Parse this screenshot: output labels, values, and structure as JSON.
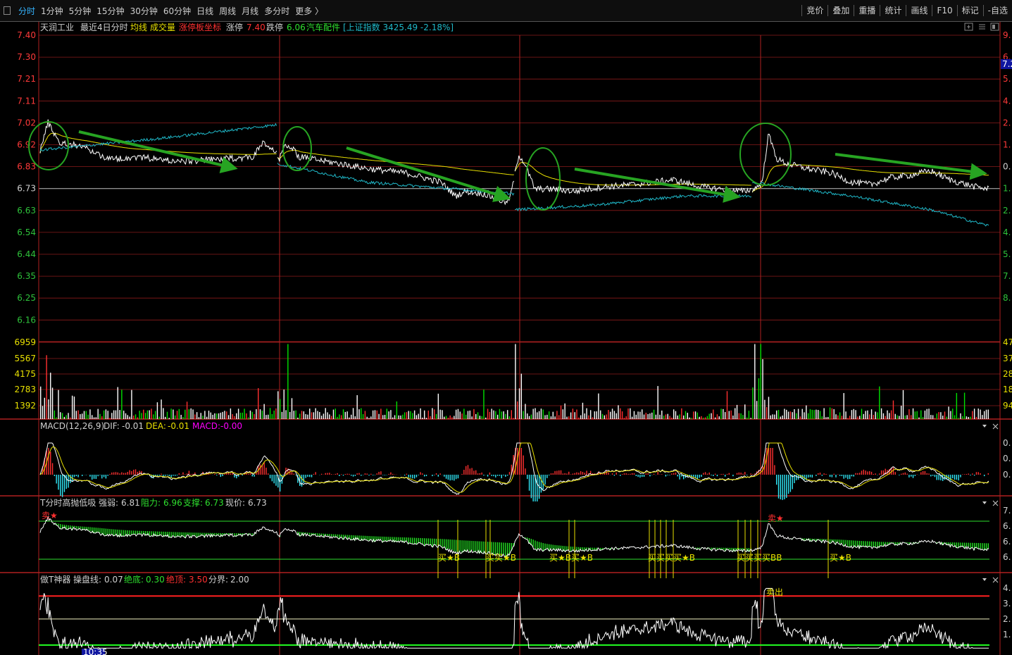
{
  "toolbar": {
    "tabs": [
      "分时",
      "1分钟",
      "5分钟",
      "15分钟",
      "30分钟",
      "60分钟",
      "日线",
      "周线",
      "月线",
      "多分时",
      "更多 〉"
    ],
    "active_tab": 0,
    "right_tools": [
      "竞价",
      "叠加",
      "重播",
      "统计",
      "画线",
      "F10",
      "标记",
      "-自选"
    ]
  },
  "header": {
    "stock_name": "天润工业",
    "range": "最近4日分时",
    "avg_label": "均线",
    "vol_label": "成交量",
    "limit_axis_label": "涨停板坐标",
    "limit_up_label": "涨停",
    "limit_up_value": "7.40",
    "limit_down_label": "跌停",
    "limit_down_value": "6.06",
    "sector": "汽车配件",
    "index_text": "[上证指数 3425.49 -2.18%]"
  },
  "price_axis": {
    "labels": [
      "7.40",
      "7.30",
      "7.21",
      "7.11",
      "7.02",
      "6.92",
      "6.83",
      "6.73",
      "6.63",
      "6.54",
      "6.44",
      "6.35",
      "6.25",
      "6.16"
    ],
    "prev_close": "6.73",
    "right_labels": [
      "9.",
      "6.",
      "5.",
      "4.",
      "2.",
      "1.",
      "0.",
      "1.",
      "2.",
      "4.",
      "5.",
      "7.",
      "8."
    ],
    "price_tag": "7.2"
  },
  "volume_axis": {
    "labels": [
      "6959",
      "5567",
      "4175",
      "2783",
      "1392"
    ],
    "right_labels": [
      "47",
      "37",
      "28",
      "18",
      "94"
    ]
  },
  "macd": {
    "title": "MACD(12,26,9)",
    "dif_label": "DIF:",
    "dif_value": "-0.01",
    "dea_label": "DEA:",
    "dea_value": "-0.01",
    "macd_label": "MACD:",
    "macd_value": "-0.00",
    "right_labels": [
      "0.",
      "0.",
      "0."
    ]
  },
  "tpanel": {
    "title": "T分时高抛低吸",
    "strength_label": "强弱:",
    "strength_value": "6.81",
    "resist_label": "阻力:",
    "resist_value": "6.96",
    "support_label": "支撑:",
    "support_value": "6.73",
    "now_label": "现价:",
    "now_value": "6.73",
    "sell_marks": [
      "卖★",
      "卖★"
    ],
    "buy_marks": [
      "买★B",
      "买买★B",
      "买★B买★B",
      "买买买买★B",
      "买买买买BB",
      "买★B"
    ],
    "right_labels": [
      "7.",
      "6.",
      "6.",
      "6."
    ]
  },
  "zuot": {
    "title": "做T神器",
    "line_label": "操盘线:",
    "line_value": "0.07",
    "bottom_label": "绝底:",
    "bottom_value": "0.30",
    "top_label": "绝顶:",
    "top_value": "3.50",
    "boundary_label": "分界:",
    "boundary_value": "2.00",
    "sell_mark": "卖出",
    "right_labels": [
      "4.",
      "3.",
      "2.",
      "1."
    ],
    "time_tag": "10:35"
  },
  "colors": {
    "grid": "#8a1a1a",
    "price": "#ffffff",
    "avg": "#e8e000",
    "index": "#1fb8c8",
    "up": "#ff3030",
    "down": "#00e000",
    "magenta": "#ff00ff",
    "arrow": "#27a422",
    "axis_text_up": "#ff3a3a",
    "axis_text_down": "#2ec23b"
  },
  "icons": [
    "panel-toggle-icon",
    "zoom-icon",
    "menu-icon",
    "restore-icon",
    "dropdown-icon",
    "close-icon"
  ]
}
